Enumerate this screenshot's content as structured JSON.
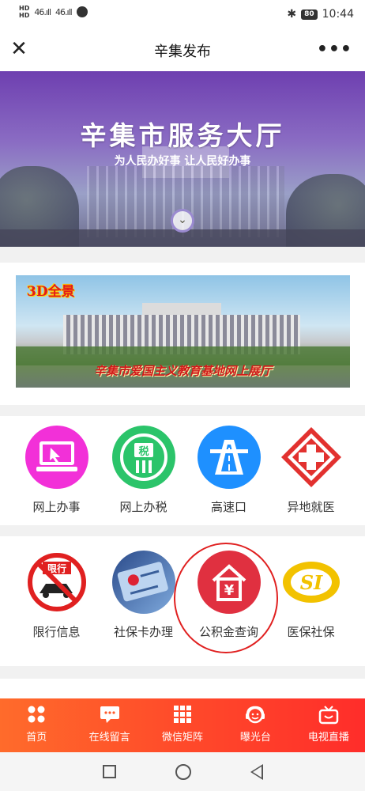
{
  "status": {
    "left_labels": [
      "HD",
      "46",
      "46"
    ],
    "battery": "80",
    "time": "10:44"
  },
  "titlebar": {
    "title": "辛集发布",
    "more": "•••"
  },
  "banner": {
    "title": "辛集市服务大厅",
    "subtitle": "为人民办好事 让人民好办事"
  },
  "panorama": {
    "badge": "3D全景",
    "caption": "辛集市爱国主义教育基地网上展厅"
  },
  "services_row1": [
    {
      "label": "网上办事",
      "icon": "computer-icon",
      "color": "#f230d8"
    },
    {
      "label": "网上办税",
      "icon": "tax-icon",
      "color": "#2bc46a"
    },
    {
      "label": "高速口",
      "icon": "highway-icon",
      "color": "#1e90ff"
    },
    {
      "label": "异地就医",
      "icon": "medical-cross-icon",
      "color": "#e2312f"
    }
  ],
  "services_row2": [
    {
      "label": "限行信息",
      "icon": "traffic-restriction-icon",
      "sign_text": "限行"
    },
    {
      "label": "社保卡办理",
      "icon": "social-security-card-icon"
    },
    {
      "label": "公积金查询",
      "icon": "housing-fund-icon",
      "color": "#e03040"
    },
    {
      "label": "医保社保",
      "icon": "si-logo-icon",
      "color": "#f2c200"
    }
  ],
  "tabbar": {
    "accent": "#ff4a2a",
    "items": [
      {
        "label": "首页",
        "icon": "home-grid-icon"
      },
      {
        "label": "在线留言",
        "icon": "message-icon"
      },
      {
        "label": "微信矩阵",
        "icon": "matrix-grid-icon"
      },
      {
        "label": "曝光台",
        "icon": "exposure-face-icon"
      },
      {
        "label": "电视直播",
        "icon": "tv-icon"
      }
    ]
  },
  "navbar": {
    "items": [
      "recent-apps-icon",
      "home-icon",
      "back-icon"
    ]
  }
}
